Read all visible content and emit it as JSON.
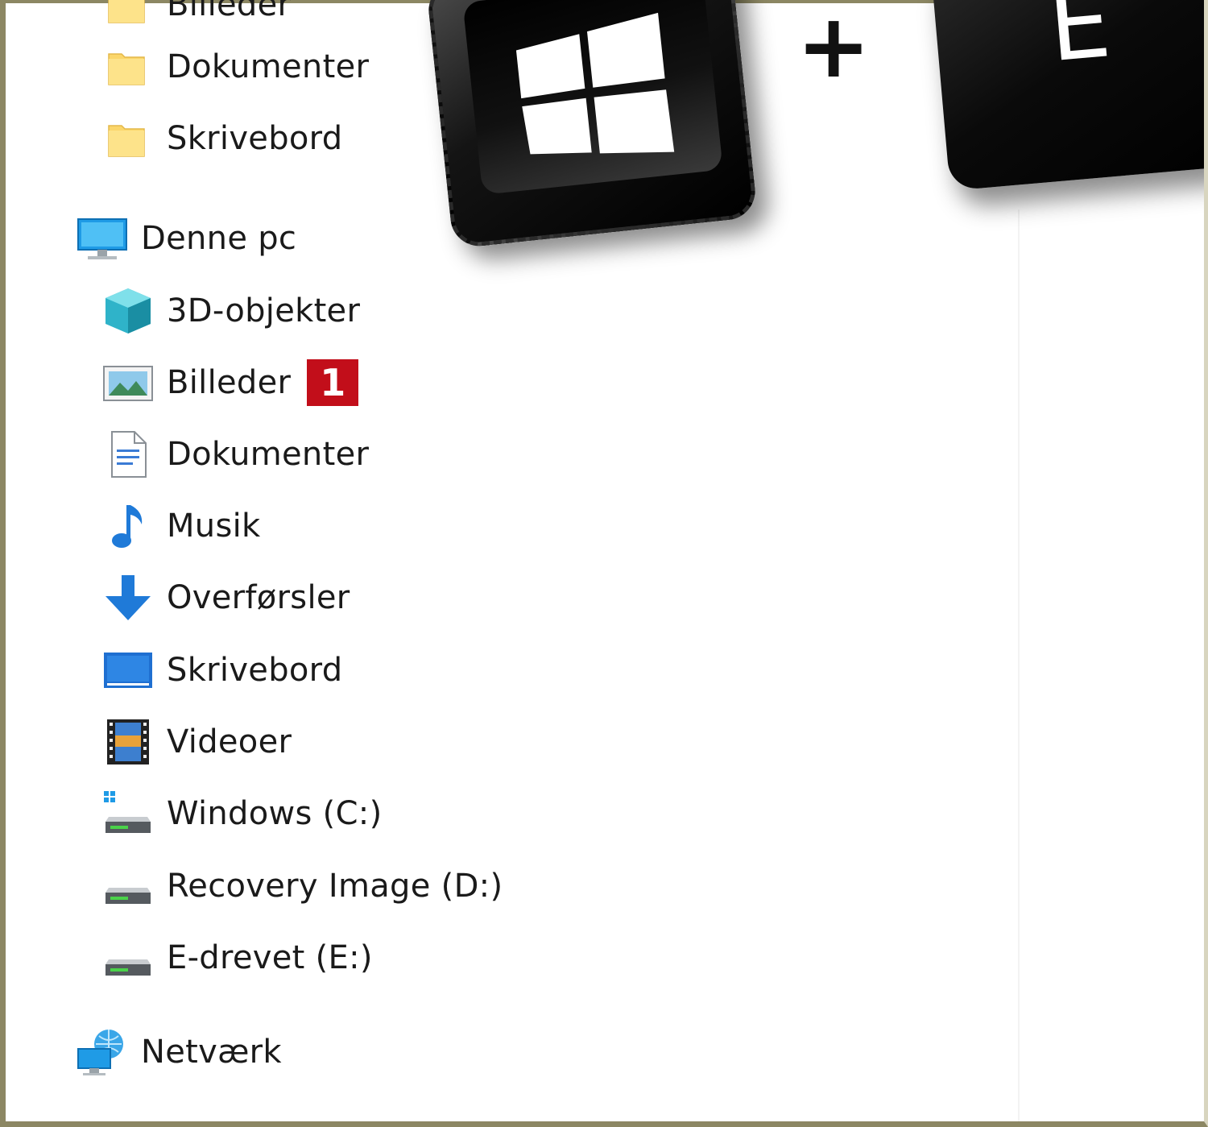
{
  "quick_access": {
    "items": [
      {
        "label": "Billeder",
        "icon": "folder-icon"
      },
      {
        "label": "Dokumenter",
        "icon": "folder-icon"
      },
      {
        "label": "Skrivebord",
        "icon": "folder-icon"
      }
    ]
  },
  "this_pc": {
    "label": "Denne pc",
    "icon": "computer-icon",
    "items": [
      {
        "label": "3D-objekter",
        "icon": "cube-3d-icon"
      },
      {
        "label": "Billeder",
        "icon": "pictures-icon",
        "badge": "1"
      },
      {
        "label": "Dokumenter",
        "icon": "document-icon"
      },
      {
        "label": "Musik",
        "icon": "music-note-icon"
      },
      {
        "label": "Overførsler",
        "icon": "download-arrow-icon"
      },
      {
        "label": "Skrivebord",
        "icon": "desktop-icon"
      },
      {
        "label": "Videoer",
        "icon": "film-icon"
      },
      {
        "label": "Windows (C:)",
        "icon": "windows-drive-icon"
      },
      {
        "label": "Recovery Image (D:)",
        "icon": "drive-icon"
      },
      {
        "label": "E-drevet (E:)",
        "icon": "drive-icon"
      }
    ]
  },
  "network": {
    "label": "Netværk",
    "icon": "network-icon"
  },
  "shortcut": {
    "plus": "+",
    "key_letter": "E",
    "key_icon": "windows-logo-icon"
  },
  "colors": {
    "badge": "#c20e1a",
    "folder": "#fbd66a",
    "accent_blue": "#1f7ad8"
  }
}
